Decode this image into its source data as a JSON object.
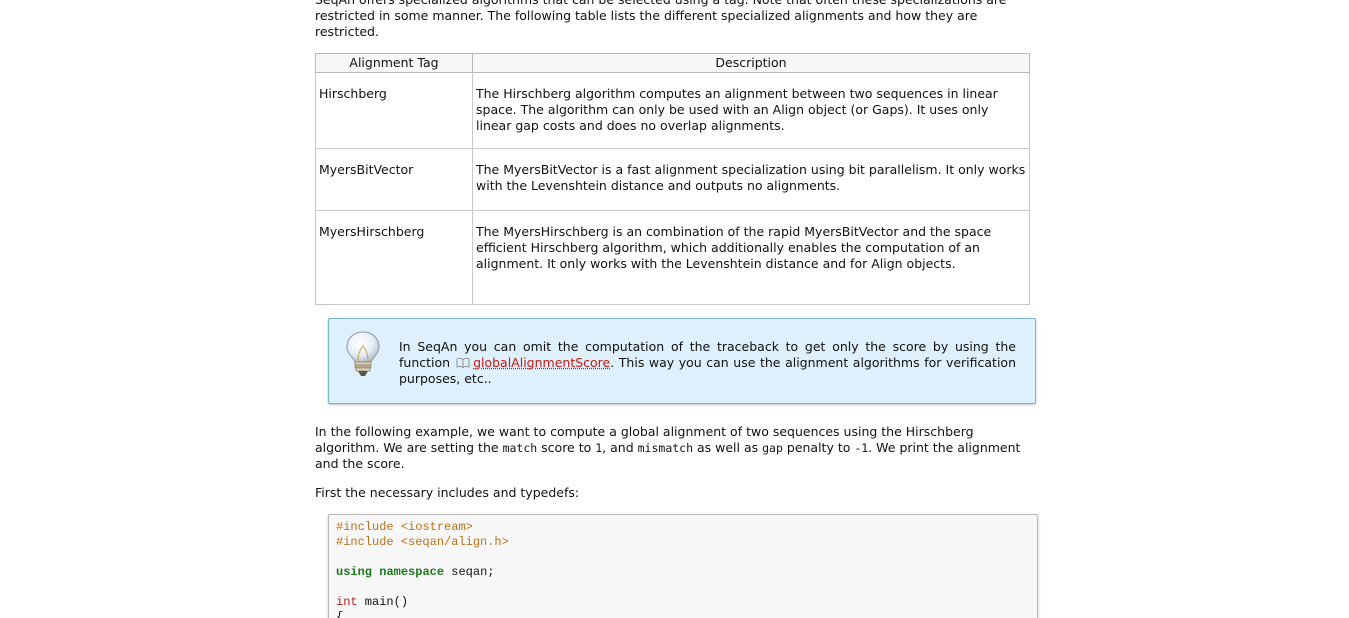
{
  "intro": "SeqAn offers specialized algorithms that can be selected using a tag. Note that often these specializations are restricted in some manner. The following table lists the different specialized alignments and how they are restricted.",
  "table": {
    "headers": [
      "Alignment Tag",
      "Description"
    ],
    "rows": [
      {
        "tag": "Hirschberg",
        "description": "The Hirschberg algorithm computes an alignment between two sequences in linear space. The algorithm can only be used with an Align object (or Gaps). It uses only linear gap costs and does no overlap alignments."
      },
      {
        "tag": "MyersBitVector",
        "description": "The MyersBitVector is a fast alignment specialization using bit parallelism. It only works with the Levenshtein distance and outputs no alignments."
      },
      {
        "tag": "MyersHirschberg",
        "description": "The MyersHirschberg is an combination of the rapid MyersBitVector and the space efficient Hirschberg algorithm, which additionally enables the computation of an alignment. It only works with the Levenshtein distance and for Align objects."
      }
    ]
  },
  "note": {
    "icon": "lightbulb-icon",
    "text_before": "In SeqAn you can omit the computation of the traceback to get only the score by using the function",
    "link_icon": "book-icon",
    "link_text": "globalAlignmentScore",
    "text_after": ". This way you can use the alignment algorithms for verification purposes, etc.."
  },
  "example": {
    "p1": "In the following example, we want to compute a global alignment of two sequences using the Hirschberg algorithm. We are setting the ",
    "code1": "match",
    "p2": " score to ",
    "code2": "1",
    "p3": ", and ",
    "code3": "mismatch",
    "p4": " as well as ",
    "code4": "gap",
    "p5": " penalty to ",
    "code5": "-1",
    "p6": ". We print the alignment and the score."
  },
  "typedefs_text": "First the necessary includes and typedefs:",
  "code": {
    "line1": "#include <iostream>",
    "line2": "#include <seqan/align.h>",
    "line4_kw1": "using",
    "line4_kw2": "namespace",
    "line4_rest": " seqan;",
    "line6_type": "int",
    "line6_rest": " main()",
    "line7": "{"
  },
  "colors": {
    "link": "#c41a16",
    "note_bg": "#def0fb",
    "preprocessor": "#b8731c",
    "keyword": "#1a7a1a",
    "type": "#b22222"
  }
}
